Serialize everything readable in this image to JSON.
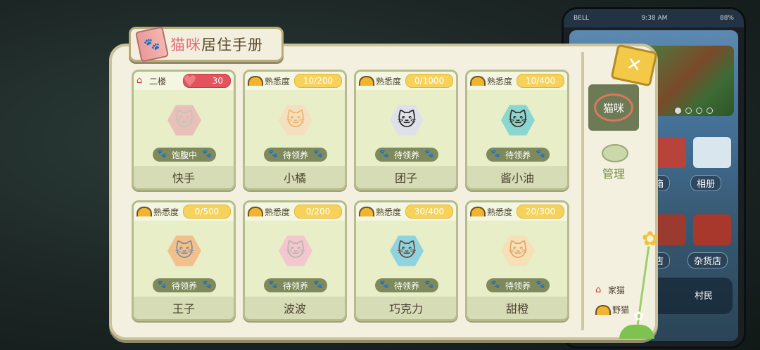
{
  "header": {
    "title_pink": "猫咪",
    "title_rest": "居住手册"
  },
  "background_phone": {
    "status_left": "BELL",
    "status_time": "9:38 AM",
    "status_battery": "88%",
    "apps": [
      {
        "label": "箱"
      },
      {
        "label": "相册"
      },
      {
        "label": "店"
      },
      {
        "label": "杂货店"
      }
    ],
    "dock_label": "村民"
  },
  "cards": [
    {
      "kind": "home",
      "location": "二楼",
      "value": "30",
      "name": "快手",
      "status": "饱腹中",
      "fur": "#c9c2bc",
      "hex": "#e9c0b8"
    },
    {
      "kind": "wild",
      "label": "熟悉度",
      "value": "10/200",
      "name": "小橘",
      "status": "待领养",
      "fur": "#f0b36a",
      "hex": "#f4dfc0"
    },
    {
      "kind": "wild",
      "label": "熟悉度",
      "value": "0/1000",
      "name": "团子",
      "status": "待领养",
      "fur": "#2a2a2a",
      "hex": "#dfe0ea"
    },
    {
      "kind": "wild",
      "label": "熟悉度",
      "value": "10/400",
      "name": "酱小油",
      "status": "待领养",
      "fur": "#3a2e2a",
      "hex": "#8ad6d0"
    },
    {
      "kind": "wild",
      "label": "熟悉度",
      "value": "0/500",
      "name": "王子",
      "status": "待领养",
      "fur": "#7d8ea8",
      "hex": "#f2c08a"
    },
    {
      "kind": "wild",
      "label": "熟悉度",
      "value": "0/200",
      "name": "波波",
      "status": "待领养",
      "fur": "#bdb4ae",
      "hex": "#f3c7cf"
    },
    {
      "kind": "wild",
      "label": "熟悉度",
      "value": "30/400",
      "name": "巧克力",
      "status": "待领养",
      "fur": "#6a4a34",
      "hex": "#8fd2e0"
    },
    {
      "kind": "wild",
      "label": "熟悉度",
      "value": "20/300",
      "name": "甜橙",
      "status": "待领养",
      "fur": "#e4a66a",
      "hex": "#f6e0b8"
    }
  ],
  "sidebar": {
    "cat_tab": "猫咪",
    "manage": "管理",
    "legend_home": "家猫",
    "legend_wild": "野猫"
  },
  "colors": {
    "accent_green": "#6e7a56",
    "card_bg": "#e8eec8",
    "pill_yellow": "#f6d25a",
    "pill_red": "#e2535e"
  }
}
